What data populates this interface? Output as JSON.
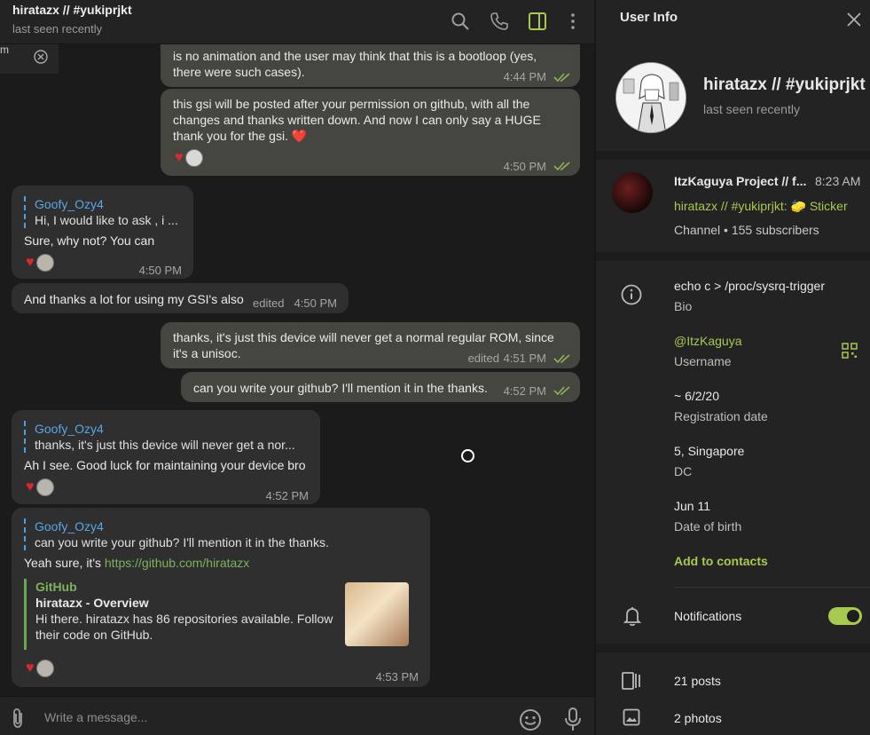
{
  "chat": {
    "title": "hiratazx // #yukiprjkt",
    "status": "last seen recently",
    "toast_text": "m",
    "messages": [
      {
        "id": "m1",
        "text_l1": "is no animation and the user may think that this is a bootloop (yes,",
        "text_l2": "there were such cases).",
        "time": "4:44 PM"
      },
      {
        "id": "m2",
        "text_l1": "this gsi will be posted after your permission on github, with all the",
        "text_l2": "changes and thanks written down. And now I can only say a HUGE",
        "text_l3": "thank you for the gsi. ❤️",
        "time": "4:50 PM"
      },
      {
        "id": "m3",
        "reply_name": "Goofy_Ozy4",
        "reply_text": "Hi, I would like to ask , i ...",
        "text": "Sure, why not? You can",
        "time": "4:50 PM"
      },
      {
        "id": "m4",
        "text": "And thanks a lot for using my GSI's also",
        "edited": "edited",
        "time": "4:50 PM"
      },
      {
        "id": "m5",
        "text_l1": "thanks, it's just this device will never get a normal regular ROM, since",
        "text_l2": "it's a unisoc.",
        "edited": "edited",
        "time": "4:51 PM"
      },
      {
        "id": "m6",
        "text": "can you write your github? I'll mention it in the thanks.",
        "time": "4:52 PM"
      },
      {
        "id": "m7",
        "reply_name": "Goofy_Ozy4",
        "reply_text": "thanks, it's just this device will never get a nor...",
        "text": "Ah I see. Good luck for maintaining your device bro",
        "time": "4:52 PM"
      },
      {
        "id": "m8",
        "reply_name": "Goofy_Ozy4",
        "reply_text": "can you write your github? I'll mention it in the thanks.",
        "text_prefix": "Yeah sure, it's ",
        "link": "https://github.com/hiratazx",
        "preview_site": "GitHub",
        "preview_title": "hiratazx - Overview",
        "preview_desc": "Hi there. hiratazx has 86 repositories available. Follow their code on GitHub.",
        "time": "4:53 PM"
      }
    ],
    "composer_placeholder": "Write a message..."
  },
  "info": {
    "header": "User Info",
    "name": "hiratazx // #yukiprjkt",
    "status": "last seen recently",
    "channel": {
      "name": "ItzKaguya Project // f...",
      "time": "8:23 AM",
      "msg_author": "hiratazx // #yukiprjkt:",
      "msg_sticker": "🧽 Sticker",
      "sub": "Channel • 155 subscribers"
    },
    "bio_value": "echo c > /proc/sysrq-trigger",
    "bio_label": "Bio",
    "username_value": "@ItzKaguya",
    "username_label": "Username",
    "reg_value": "~ 6/2/20",
    "reg_label": "Registration date",
    "dc_value": "5, Singapore",
    "dc_label": "DC",
    "dob_value": "Jun 11",
    "dob_label": "Date of birth",
    "add_contacts": "Add to contacts",
    "notifications": "Notifications",
    "posts": "21 posts",
    "photos": "2 photos"
  },
  "colors": {
    "accent": "#a7c950",
    "link_blue": "#58a6e6",
    "heart": "#e3262c"
  }
}
